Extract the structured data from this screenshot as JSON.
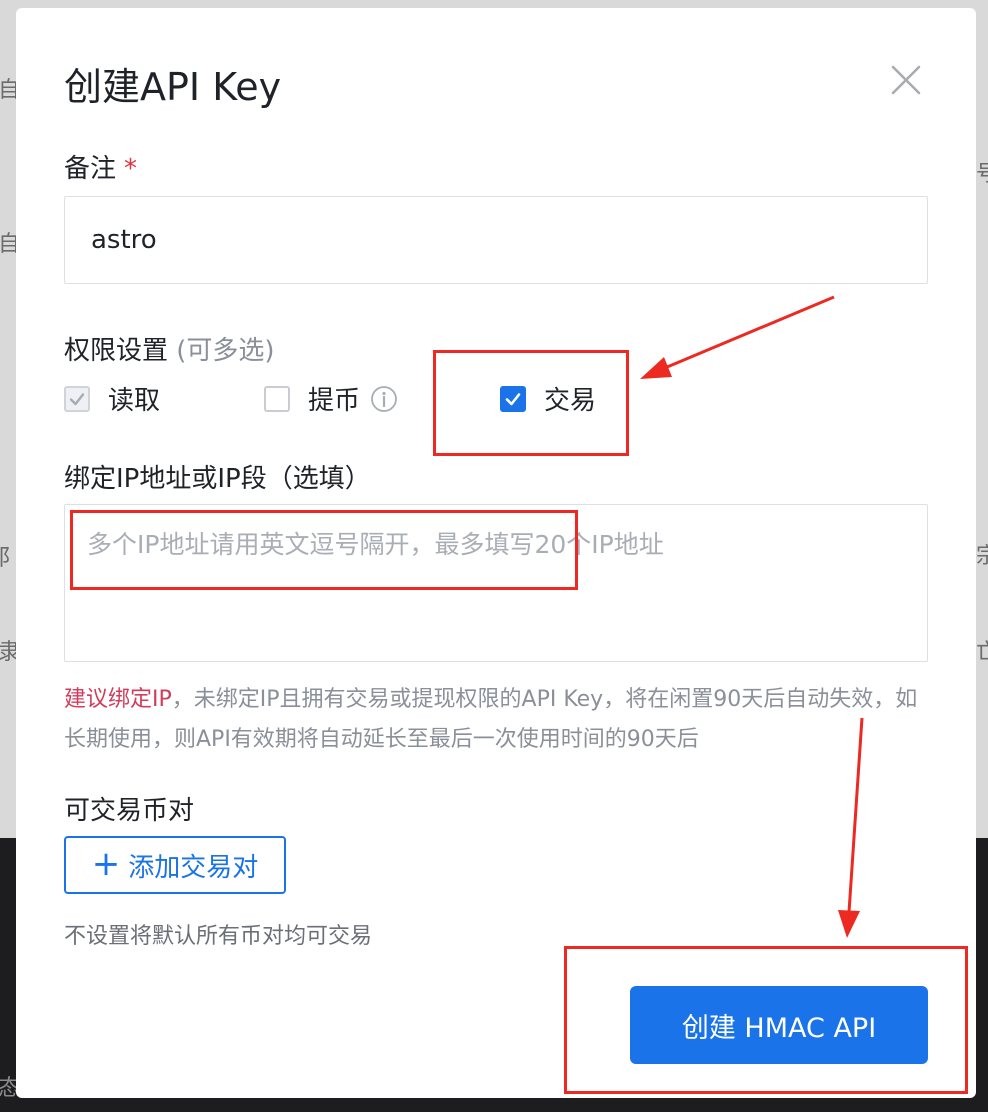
{
  "modal": {
    "title": "创建API Key"
  },
  "remark": {
    "label": "备注",
    "required_mark": "*",
    "value": "astro"
  },
  "permissions": {
    "label": "权限设置",
    "hint": "(可多选)",
    "options": [
      {
        "label": "读取",
        "state": "checked-disabled"
      },
      {
        "label": "提币",
        "state": "unchecked"
      },
      {
        "label": "交易",
        "state": "checked"
      }
    ]
  },
  "ip": {
    "label": "绑定IP地址或IP段（选填）",
    "placeholder": "多个IP地址请用英文逗号隔开，最多填写20个IP地址",
    "note_highlight": "建议绑定IP",
    "note_rest": "，未绑定IP且拥有交易或提现权限的API Key，将在闲置90天后自动失效，如长期使用，则API有效期将自动延长至最后一次使用时间的90天后"
  },
  "pairs": {
    "label": "可交易币对",
    "add_button": "添加交易对",
    "note": "不设置将默认所有币对均可交易"
  },
  "actions": {
    "create_button": "创建 HMAC API"
  },
  "background_fragments": [
    "自",
    "自",
    "阝",
    "隶",
    "宗",
    "号",
    "亡",
    "态"
  ],
  "colors": {
    "primary": "#1a73e8",
    "warning": "#d23c5a",
    "annotation": "#ec2a22"
  }
}
